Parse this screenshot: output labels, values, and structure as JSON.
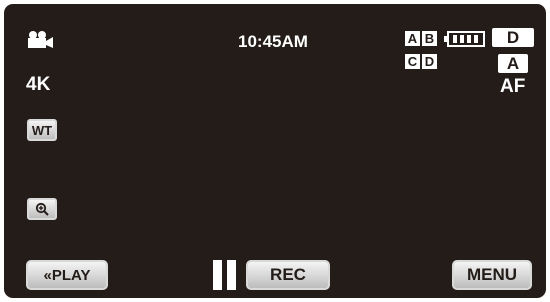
{
  "status": {
    "time": "10:45AM",
    "resolution": "4K",
    "zoom_button": "WT",
    "camera_mode_icon": "video-camera-icon",
    "battery_icon": "battery-icon",
    "mode_badge": "D",
    "auto_badge": "A",
    "focus_mode": "AF",
    "media_slots": [
      "A",
      "B",
      "C",
      "D"
    ],
    "magnify_icon": "magnifier-plus-icon",
    "pause_icon": "pause-icon"
  },
  "buttons": {
    "play": "«PLAY",
    "rec": "REC",
    "menu": "MENU"
  }
}
